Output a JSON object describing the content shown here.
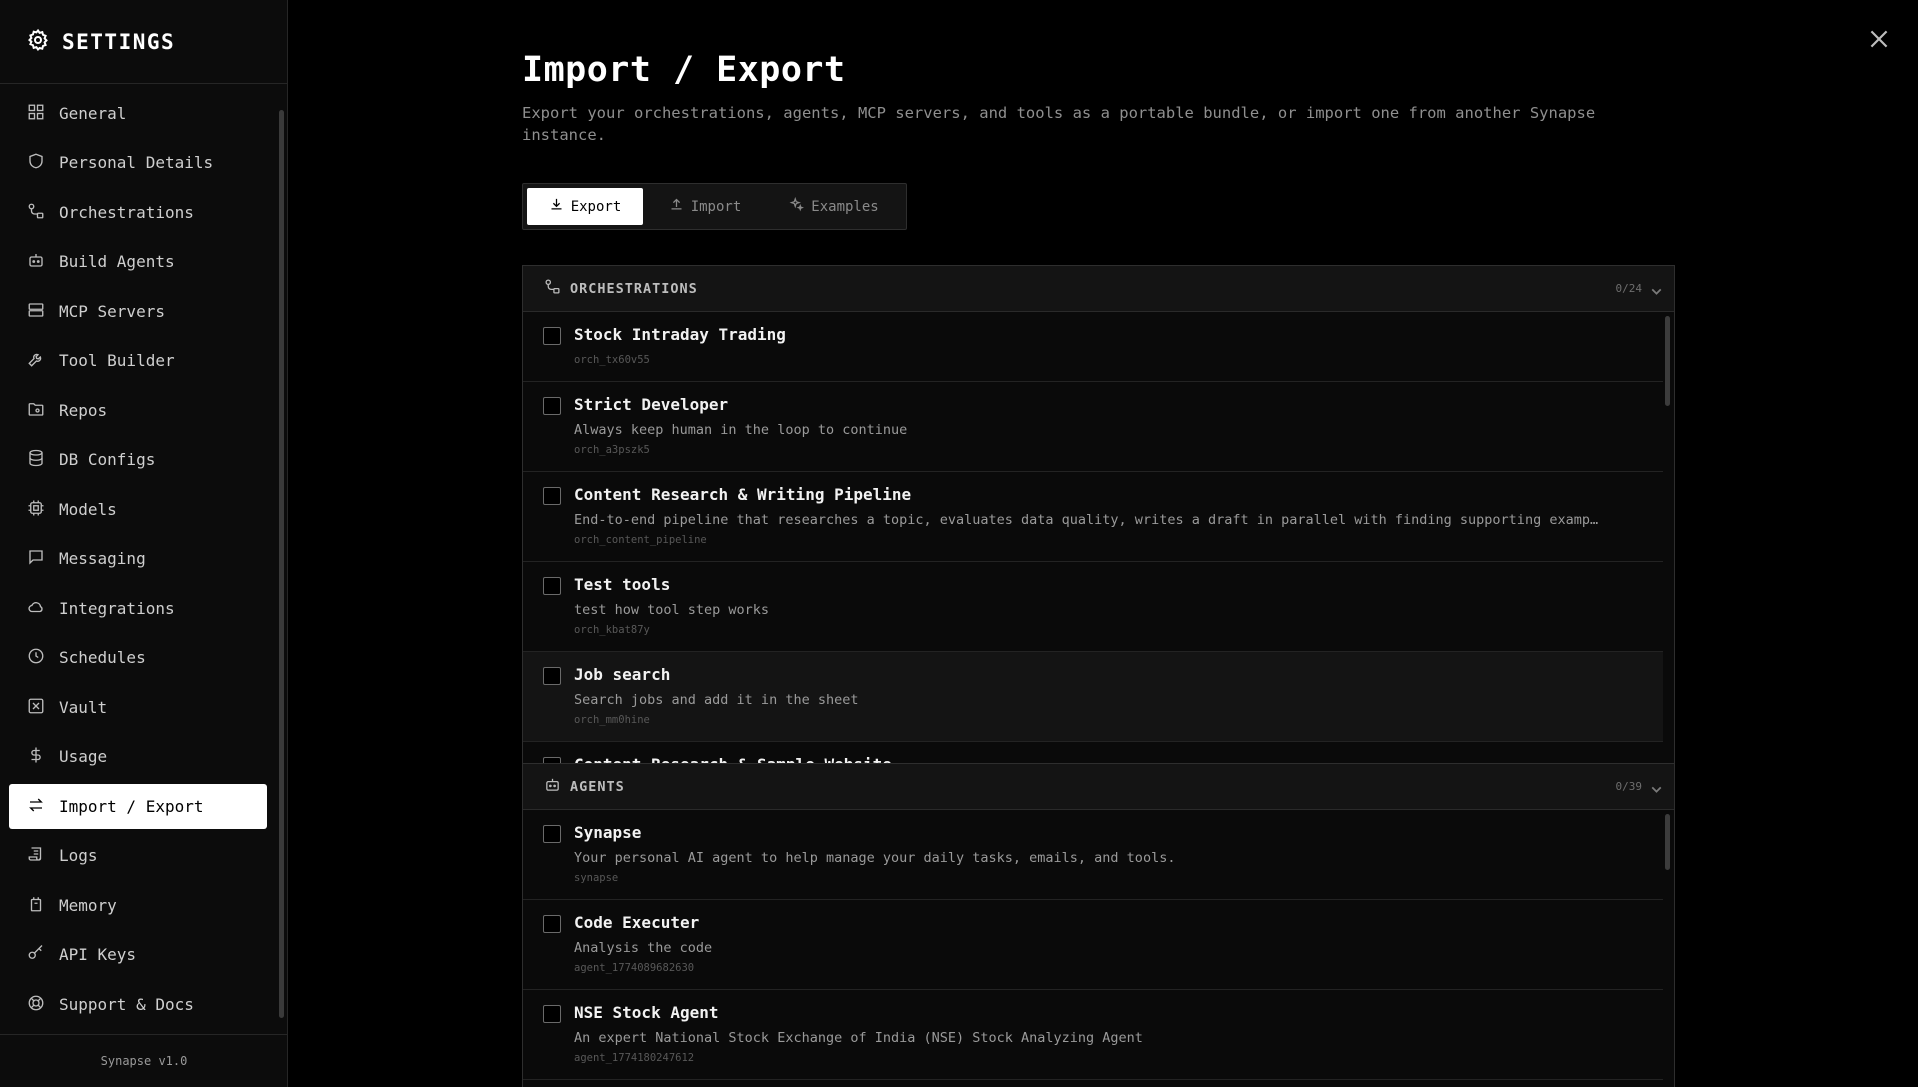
{
  "sidebar": {
    "title": "SETTINGS",
    "items": [
      {
        "label": "General",
        "icon": "grid-icon"
      },
      {
        "label": "Personal Details",
        "icon": "shield-icon"
      },
      {
        "label": "Orchestrations",
        "icon": "workflow-icon"
      },
      {
        "label": "Build Agents",
        "icon": "bot-icon"
      },
      {
        "label": "MCP Servers",
        "icon": "server-icon"
      },
      {
        "label": "Tool Builder",
        "icon": "wrench-icon"
      },
      {
        "label": "Repos",
        "icon": "folder-git-icon"
      },
      {
        "label": "DB Configs",
        "icon": "database-icon"
      },
      {
        "label": "Models",
        "icon": "cpu-icon"
      },
      {
        "label": "Messaging",
        "icon": "message-icon"
      },
      {
        "label": "Integrations",
        "icon": "cloud-icon"
      },
      {
        "label": "Schedules",
        "icon": "clock-icon"
      },
      {
        "label": "Vault",
        "icon": "vault-icon"
      },
      {
        "label": "Usage",
        "icon": "dollar-icon"
      },
      {
        "label": "Import / Export",
        "icon": "arrows-swap-icon",
        "active": true
      },
      {
        "label": "Logs",
        "icon": "scroll-icon"
      },
      {
        "label": "Memory",
        "icon": "memory-icon"
      },
      {
        "label": "API Keys",
        "icon": "key-icon"
      },
      {
        "label": "Support & Docs",
        "icon": "lifebuoy-icon"
      }
    ],
    "footer": "Synapse v1.0"
  },
  "main": {
    "title": "Import / Export",
    "description": "Export your orchestrations, agents, MCP servers, and tools as a portable bundle, or import one from another Synapse instance.",
    "tabs": [
      {
        "label": "Export",
        "icon": "download-icon",
        "active": true
      },
      {
        "label": "Import",
        "icon": "upload-icon"
      },
      {
        "label": "Examples",
        "icon": "sparkles-icon"
      }
    ]
  },
  "orchestrations": {
    "title": "ORCHESTRATIONS",
    "count": "0/24",
    "items": [
      {
        "name": "Stock Intraday Trading",
        "desc": "",
        "id": "orch_tx60v55"
      },
      {
        "name": "Strict Developer",
        "desc": "Always keep human in the loop to continue",
        "id": "orch_a3pszk5"
      },
      {
        "name": "Content Research & Writing Pipeline",
        "desc": "End-to-end pipeline that researches a topic, evaluates data quality, writes a draft in parallel with finding supporting examples, and then reviews the final output",
        "id": "orch_content_pipeline"
      },
      {
        "name": "Test tools",
        "desc": "test how tool step works",
        "id": "orch_kbat87y"
      },
      {
        "name": "Job search",
        "desc": "Search jobs and add it in the sheet",
        "id": "orch_mm0hine"
      },
      {
        "name": "Content Research & Sample Website",
        "desc": "",
        "id": ""
      }
    ]
  },
  "agents": {
    "title": "AGENTS",
    "count": "0/39",
    "items": [
      {
        "name": "Synapse",
        "desc": "Your personal AI agent to help manage your daily tasks, emails, and tools.",
        "id": "synapse"
      },
      {
        "name": "Code Executer",
        "desc": "Analysis the code",
        "id": "agent_1774089682630"
      },
      {
        "name": "NSE Stock Agent",
        "desc": "An expert National Stock Exchange of India (NSE) Stock Analyzing Agent",
        "id": "agent_1774180247612"
      }
    ]
  }
}
